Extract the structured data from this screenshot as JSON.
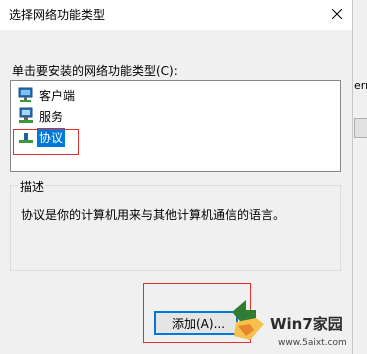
{
  "background_window": {
    "partial_text": "erm"
  },
  "dialog": {
    "title": "选择网络功能类型",
    "list_label": "单击要安装的网络功能类型(C):",
    "items": [
      {
        "label": "客户端",
        "icon": "network-client-icon",
        "selected": false
      },
      {
        "label": "服务",
        "icon": "network-service-icon",
        "selected": false
      },
      {
        "label": "协议",
        "icon": "network-protocol-icon",
        "selected": true
      }
    ],
    "description": {
      "title": "描述",
      "text": "协议是你的计算机用来与其他计算机通信的语言。"
    },
    "add_button": "添加(A)..."
  },
  "watermark": {
    "name": "Win7家园",
    "url": "www.5aixt.com"
  },
  "colors": {
    "selection": "#0078d7",
    "highlight_box": "#e03030",
    "dialog_bg": "#f0f0f0"
  }
}
